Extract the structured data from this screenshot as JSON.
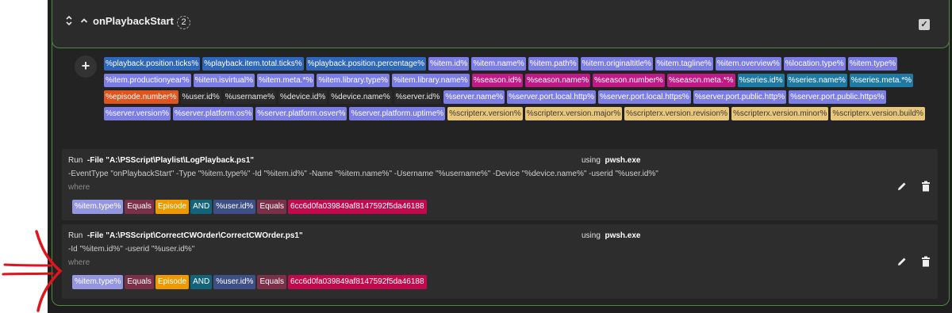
{
  "header": {
    "title": "onPlaybackStart",
    "count": "2",
    "collapse_icon": "chevron-up-icon",
    "sort_icon": "updown-icon",
    "check_icon": "checkbox-icon"
  },
  "variables": [
    {
      "text": "%playback.position.ticks%",
      "color": "blue"
    },
    {
      "text": "%playback.item.total.ticks%",
      "color": "blue"
    },
    {
      "text": "%playback.position.percentage%",
      "color": "blue"
    },
    {
      "text": "%item.id%",
      "color": "lav"
    },
    {
      "text": "%item.name%",
      "color": "lav"
    },
    {
      "text": "%item.path%",
      "color": "lav"
    },
    {
      "text": "%item.originaltitle%",
      "color": "lav"
    },
    {
      "text": "%item.tagline%",
      "color": "lav"
    },
    {
      "text": "%item.overview%",
      "color": "lav"
    },
    {
      "text": "%location.type%",
      "color": "lav"
    },
    {
      "text": "%item.type%",
      "color": "lav"
    },
    {
      "text": "%item.productionyear%",
      "color": "lav"
    },
    {
      "text": "%item.isvirtual%",
      "color": "lav"
    },
    {
      "text": "%item.meta.*%",
      "color": "lav"
    },
    {
      "text": "%item.library.type%",
      "color": "lav"
    },
    {
      "text": "%item.library.name%",
      "color": "lav"
    },
    {
      "text": "%season.id%",
      "color": "mag"
    },
    {
      "text": "%season.name%",
      "color": "mag"
    },
    {
      "text": "%season.number%",
      "color": "mag"
    },
    {
      "text": "%season.meta.*%",
      "color": "mag"
    },
    {
      "text": "%series.id%",
      "color": "teal"
    },
    {
      "text": "%series.name%",
      "color": "teal"
    },
    {
      "text": "%series.meta.*%",
      "color": "teal"
    },
    {
      "text": "%episode.number%",
      "color": "org"
    },
    {
      "text": "%user.id%",
      "color": "dark"
    },
    {
      "text": "%username%",
      "color": "dark"
    },
    {
      "text": "%device.id%",
      "color": "dark"
    },
    {
      "text": "%device.name%",
      "color": "dark"
    },
    {
      "text": "%server.id%",
      "color": "dark"
    },
    {
      "text": "%server.name%",
      "color": "lav"
    },
    {
      "text": "%server.port.local.http%",
      "color": "lav"
    },
    {
      "text": "%server.port.local.https%",
      "color": "lav"
    },
    {
      "text": "%server.port.public.http%",
      "color": "lav"
    },
    {
      "text": "%server.port.public.https%",
      "color": "lav"
    },
    {
      "text": "%server.version%",
      "color": "lav"
    },
    {
      "text": "%server.platform.os%",
      "color": "lav"
    },
    {
      "text": "%server.platform.osver%",
      "color": "lav"
    },
    {
      "text": "%server.platform.uptime%",
      "color": "lav"
    },
    {
      "text": "%scripterx.version%",
      "color": "yel"
    },
    {
      "text": "%scripterx.version.major%",
      "color": "yel"
    },
    {
      "text": "%scripterx.version.revision%",
      "color": "yel"
    },
    {
      "text": "%scripterx.version.minor%",
      "color": "yel"
    },
    {
      "text": "%scripterx.version.build%",
      "color": "yel"
    }
  ],
  "cards": [
    {
      "run_label": "Run",
      "file": "-File \"A:\\PSScript\\Playlist\\LogPlayback.ps1\"",
      "using_label": "using",
      "exe": "pwsh.exe",
      "args": "-EventType \"onPlaybackStart\" -Type \"%item.type%\" -Id \"%item.id%\" -Name \"%item.name%\" -Username \"%username%\" -Device \"%device.name%\" -userid \"%user.id%\"",
      "where_label": "where",
      "conditions": [
        {
          "text": "%item.type%",
          "style": "lav"
        },
        {
          "text": "Equals",
          "style": "plum"
        },
        {
          "text": "Episode",
          "style": "gold"
        },
        {
          "text": "AND",
          "style": "tealdk"
        },
        {
          "text": "%user.id%",
          "style": "navy"
        },
        {
          "text": "Equals",
          "style": "plum"
        },
        {
          "text": "6cc6d0fa039849af8147592f5da46188",
          "style": "red"
        }
      ]
    },
    {
      "run_label": "Run",
      "file": "-File \"A:\\PSScript\\CorrectCWOrder\\CorrectCWOrder.ps1\"",
      "using_label": "using",
      "exe": "pwsh.exe",
      "args": "-Id \"%item.id%\" -userid \"%user.id%\"",
      "where_label": "where",
      "conditions": [
        {
          "text": "%item.type%",
          "style": "lav"
        },
        {
          "text": "Equals",
          "style": "plum"
        },
        {
          "text": "Episode",
          "style": "gold"
        },
        {
          "text": "AND",
          "style": "tealdk"
        },
        {
          "text": "%user.id%",
          "style": "navy"
        },
        {
          "text": "Equals",
          "style": "plum"
        },
        {
          "text": "6cc6d0fa039849af8147592f5da46188",
          "style": "red"
        }
      ]
    }
  ],
  "annotation": {
    "icon": "red-hand-drawn-arrow-icon",
    "color": "#e0141e"
  }
}
